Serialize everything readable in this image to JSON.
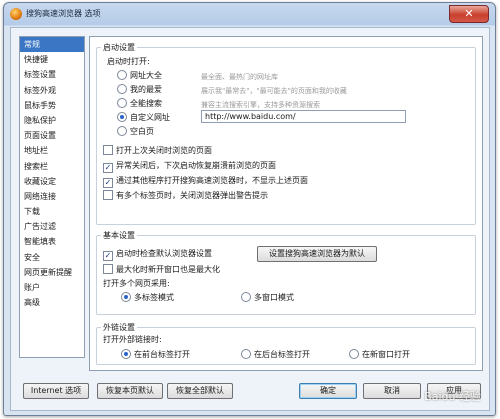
{
  "window": {
    "title": "搜狗高速浏览器 选项",
    "close_symbol": "✕"
  },
  "sidebar": {
    "items": [
      {
        "label": "常规",
        "active": true
      },
      {
        "label": "快捷键"
      },
      {
        "label": "标签设置"
      },
      {
        "label": "标签外观"
      },
      {
        "label": "鼠标手势"
      },
      {
        "label": "隐私保护"
      },
      {
        "label": "页面设置"
      },
      {
        "label": "地址栏"
      },
      {
        "label": "搜索栏"
      },
      {
        "label": "收藏设定"
      },
      {
        "label": "网络连接"
      },
      {
        "label": "下载"
      },
      {
        "label": "广告过滤"
      },
      {
        "label": "智能填表"
      },
      {
        "label": "安全"
      },
      {
        "label": "网页更新提醒"
      },
      {
        "label": "账户"
      },
      {
        "label": "高级"
      }
    ]
  },
  "startup": {
    "group_title": "启动设置",
    "open_label": "启动时打开:",
    "options": [
      {
        "label": "网址大全",
        "hint": "最全面、最热门的网址库",
        "selected": false
      },
      {
        "label": "我的最爱",
        "hint": "展示我\"最常去\"，\"最可能去\"的页面和我的收藏",
        "selected": false
      },
      {
        "label": "全能搜索",
        "hint": "兼容主流搜索引擎，支持多种资源搜索",
        "selected": false
      },
      {
        "label": "自定义网址",
        "hint": "",
        "selected": true
      },
      {
        "label": "空白页",
        "hint": "",
        "selected": false
      }
    ],
    "custom_url": "http://www.baidu.com/",
    "checkboxes": [
      {
        "label": "打开上次关闭时浏览的页面",
        "checked": false
      },
      {
        "label": "异常关闭后，下次启动恢复崩溃前浏览的页面",
        "checked": true
      },
      {
        "label": "通过其他程序打开搜狗高速浏览器时，不显示上述页面",
        "checked": true
      },
      {
        "label": "有多个标签页时，关闭浏览器弹出警告提示",
        "checked": false
      }
    ]
  },
  "basic": {
    "group_title": "基本设置",
    "check_default": {
      "label": "启动时检查默认浏览器设置",
      "checked": true
    },
    "set_default_button": "设置搜狗高速浏览器为默认",
    "maximize": {
      "label": "最大化时新开窗口也是最大化",
      "checked": false
    },
    "multi_label": "打开多个网页采用:",
    "multi_options": [
      {
        "label": "多标签模式",
        "selected": true
      },
      {
        "label": "多窗口模式",
        "selected": false
      }
    ]
  },
  "external": {
    "group_title": "外链设置",
    "open_label": "打开外部链接时:",
    "options": [
      {
        "label": "在前台标签打开",
        "selected": true
      },
      {
        "label": "在后台标签打开",
        "selected": false
      },
      {
        "label": "在新窗口打开",
        "selected": false
      }
    ]
  },
  "footer": {
    "internet_options": "Internet 选项",
    "restore_page": "恢复本页默认",
    "restore_all": "恢复全部默认",
    "ok": "确定",
    "cancel": "取消",
    "apply": "应用"
  },
  "watermark": "Baidu 经验"
}
